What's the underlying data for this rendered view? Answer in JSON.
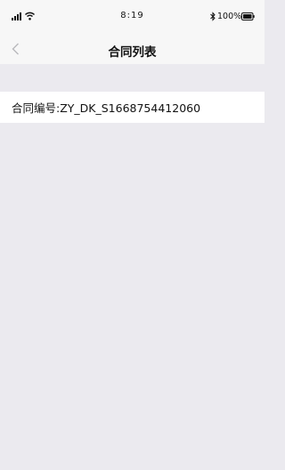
{
  "status_bar": {
    "time": "8:19",
    "battery_percent": "100%",
    "icons": [
      "cellular-signal-icon",
      "wifi-icon",
      "bluetooth-icon",
      "battery-icon"
    ]
  },
  "nav": {
    "title": "合同列表",
    "back_icon": "chevron-left-icon"
  },
  "contracts": [
    {
      "label": "合同编号:ZY_DK_S1668754412060"
    }
  ],
  "colors": {
    "background": "#ebeaef",
    "bar": "#f7f7f7",
    "row": "#ffffff",
    "back_chevron": "#b8b8bc"
  }
}
